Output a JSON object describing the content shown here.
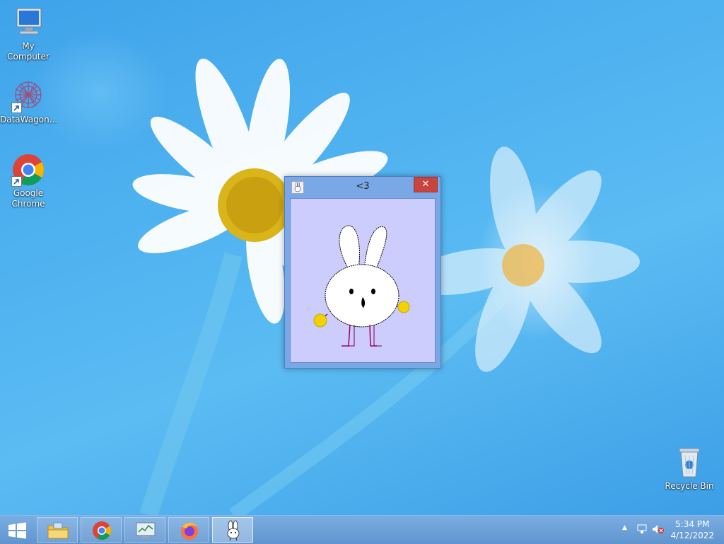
{
  "desktop": {
    "icons": [
      {
        "name": "my-computer",
        "label": "My Computer"
      },
      {
        "name": "datawagon",
        "label": "DataWagon..."
      },
      {
        "name": "google-chrome",
        "label": "Google Chrome"
      },
      {
        "name": "recycle-bin",
        "label": "Recycle Bin"
      }
    ]
  },
  "window": {
    "title": "<3",
    "close_glyph": "✕",
    "content_image": "bunny-drawing",
    "client_bg": "#cdcdfd"
  },
  "taskbar": {
    "start_icon": "windows-logo-icon",
    "buttons": [
      {
        "name": "file-explorer",
        "icon": "folder-icon"
      },
      {
        "name": "chrome",
        "icon": "chrome-icon"
      },
      {
        "name": "resource-monitor",
        "icon": "monitor-icon"
      },
      {
        "name": "firefox",
        "icon": "firefox-icon"
      },
      {
        "name": "bunny-app",
        "icon": "bunny-icon",
        "active": true
      }
    ],
    "tray": {
      "chevron": "▲",
      "time": "5:34 PM",
      "date": "4/12/2022"
    }
  }
}
